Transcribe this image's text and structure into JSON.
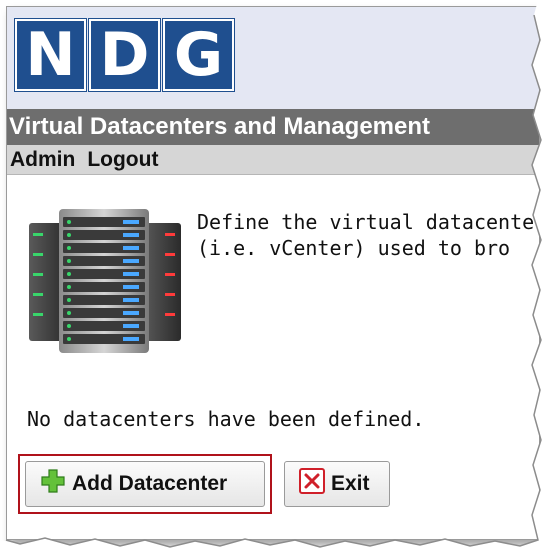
{
  "app": {
    "logo_letters": [
      "N",
      "D",
      "G"
    ],
    "title": "Virtual Datacenters and Management",
    "brand_color": "#1f4f8f"
  },
  "menu": {
    "items": [
      {
        "label": "Admin"
      },
      {
        "label": "Logout"
      }
    ]
  },
  "main": {
    "intro_lines": [
      "Define the virtual datacenter",
      "(i.e. vCenter) used to bro"
    ],
    "empty_message": "No datacenters have been defined.",
    "icon": "server-rack-icon"
  },
  "actions": {
    "add_label": "Add Datacenter",
    "add_icon": "plus-icon",
    "exit_label": "Exit",
    "exit_icon": "close-icon",
    "highlight_color": "#b0121b"
  }
}
